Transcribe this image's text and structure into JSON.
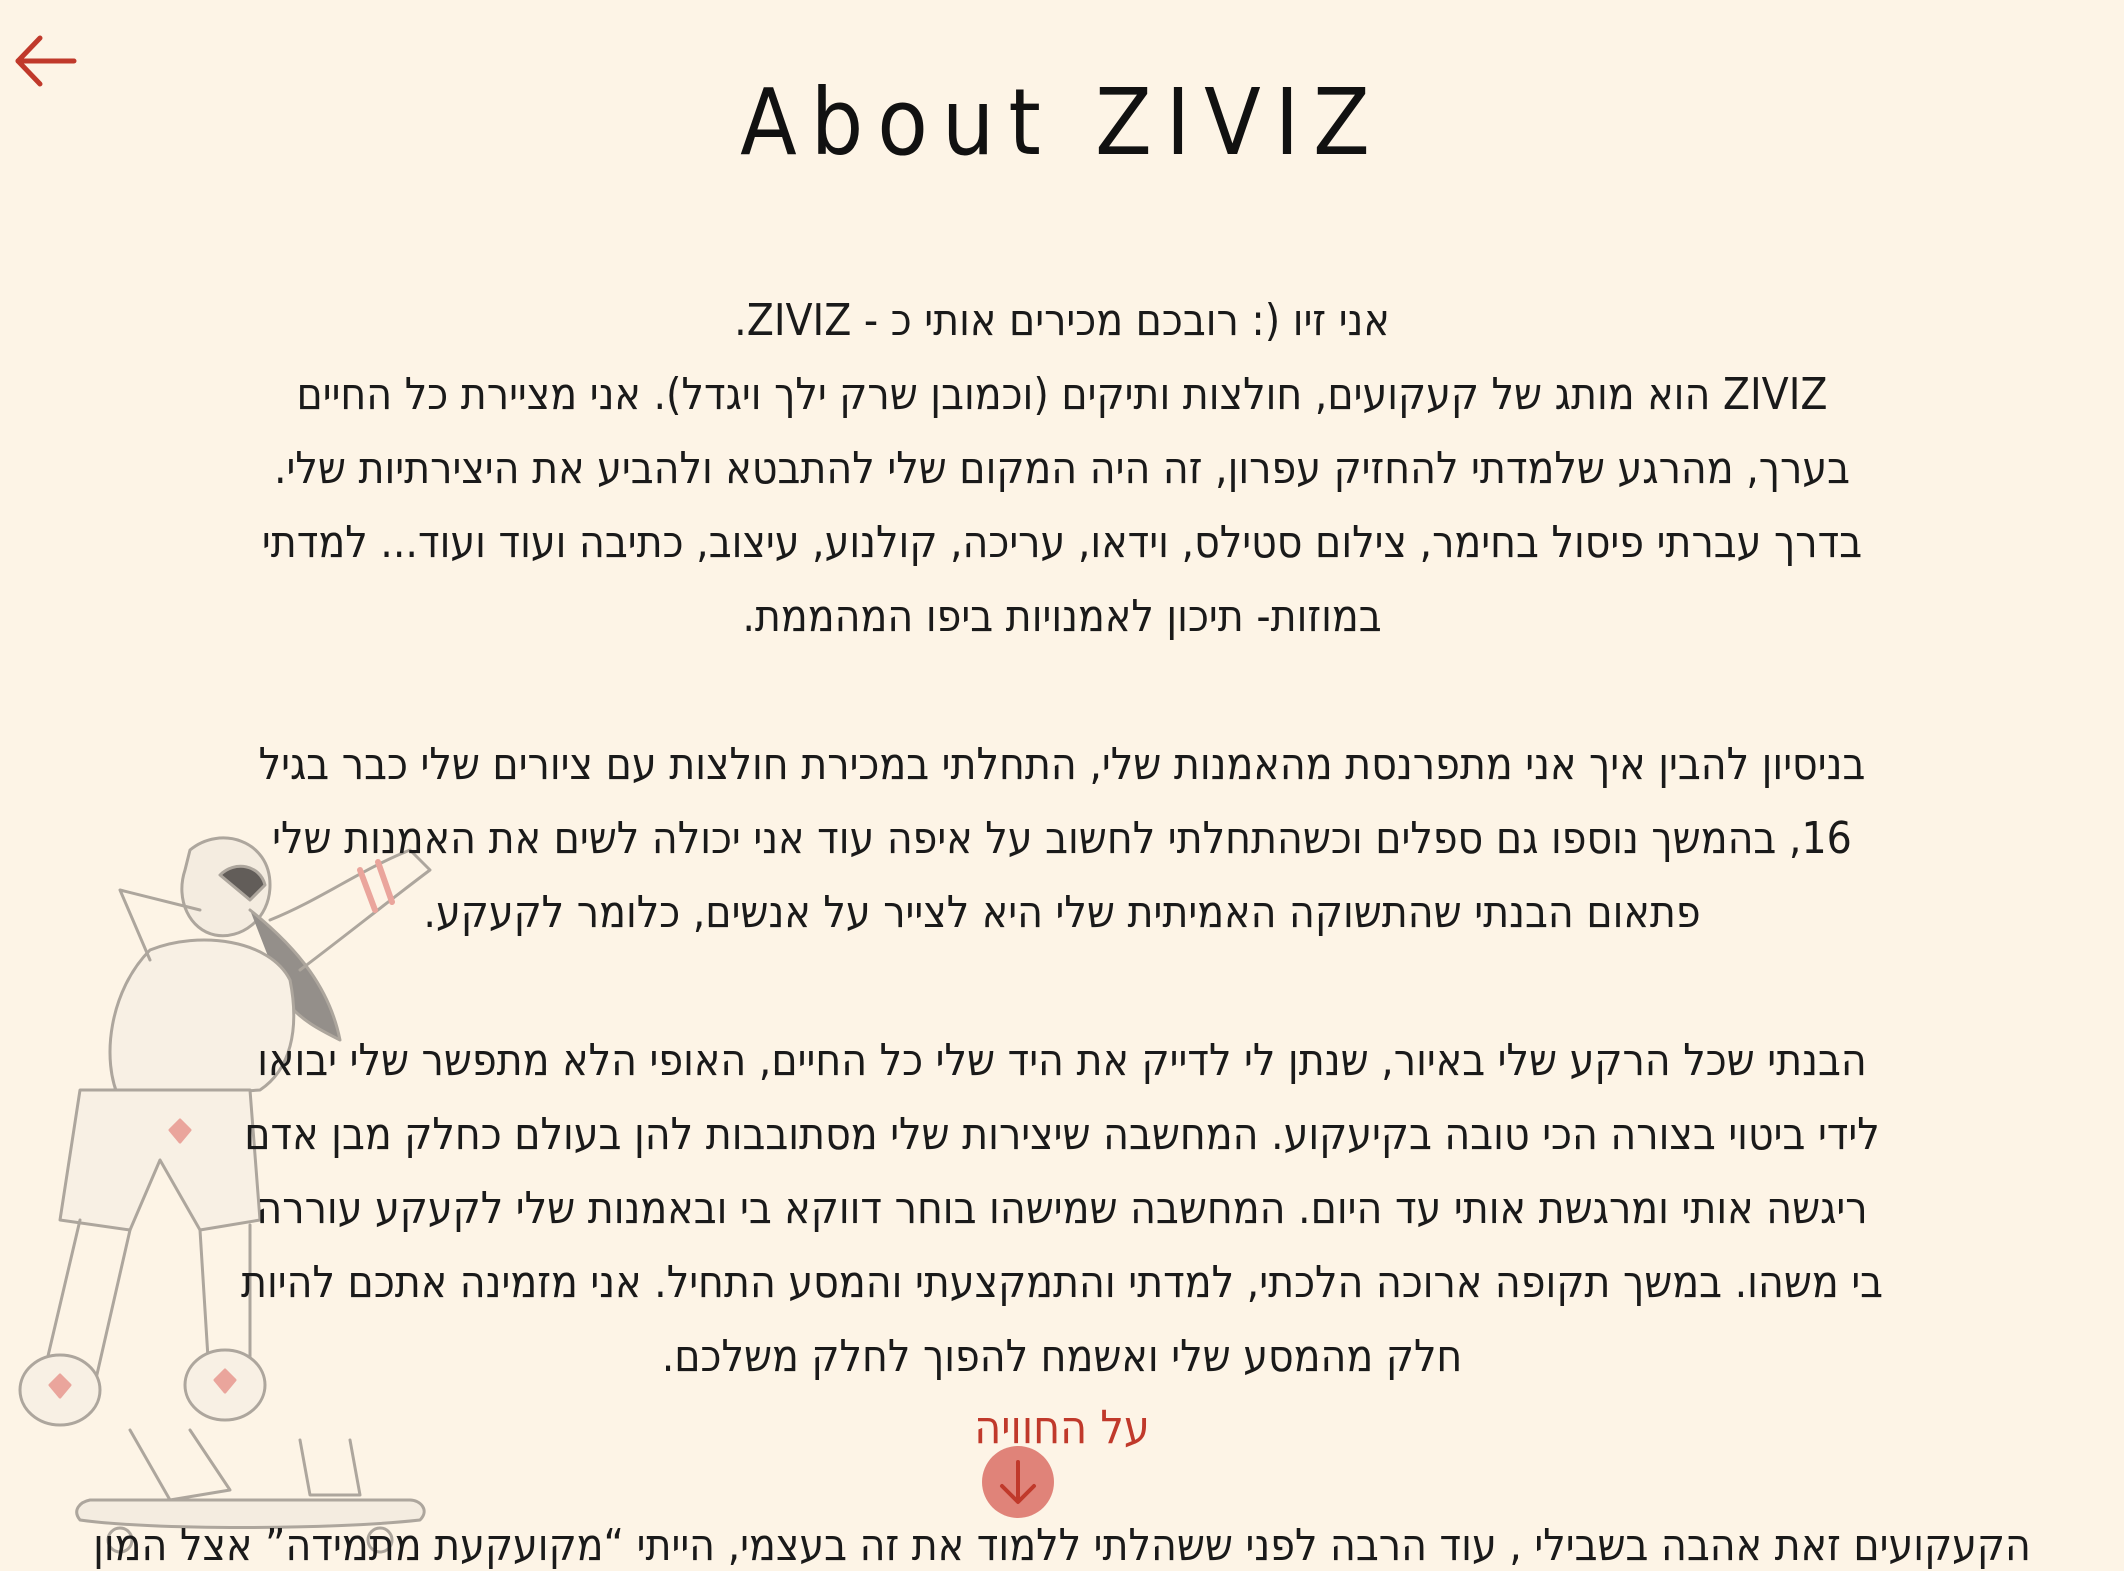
{
  "title": "About ZIVIZ",
  "paragraphs": [
    "אני זיו (: רובכם מכירים אותי כ - ZIVIZ.",
    "ZIVIZ הוא מותג של קעקועים, חולצות ותיקים (וכמובן שרק ילך ויגדל). אני מציירת כל החיים בערך, מהרגע שלמדתי להחזיק עפרון, זה היה המקום שלי להתבטא ולהביע את היצירתיות שלי. בדרך עברתי פיסול בחימר, צילום סטילס, וידאו, עריכה, קולנוע, עיצוב, כתיבה ועוד ועוד... למדתי במוזות- תיכון לאמנויות ביפו המהממת.",
    "בניסיון להבין איך אני מתפרנסת מהאמנות שלי, התחלתי במכירת חולצות עם ציורים שלי כבר בגיל 16, בהמשך נוספו גם ספלים וכשהתחלתי לחשוב על איפה עוד אני יכולה לשים את האמנות שלי פתאום הבנתי שהתשוקה האמיתית שלי היא לצייר על אנשים, כלומר לקעקע.",
    "הבנתי שכל הרקע שלי באיור, שנתן לי לדייק את היד שלי כל החיים, האופי הלא מתפשר שלי יבואו לידי ביטוי בצורה הכי טובה בקיעקוע. המחשבה שיצירות שלי מסתובבות להן בעולם כחלק מבן אדם ריגשה אותי ומרגשת אותי עד היום. המחשבה שמישהו בוחר דווקא בי ובאמנות שלי לקעקע עוררה בי משהו. במשך תקופה ארוכה הלכתי, למדתי והתמקצעתי והמסע התחיל. אני מזמינה אתכם להיות חלק מהמסע שלי ואשמח להפוך לחלק משלכם."
  ],
  "cta_label": "על החוויה",
  "cut_text": "הקעקועים זאת אהבה בשבילי , עוד הרבה לפני ששהלתי ללמוד את זה בעצמי, הייתי “מקועקעת מתמידה” אצל המון",
  "icons": {
    "back": "arrow-left-icon",
    "scroll": "arrow-down-icon"
  },
  "colors": {
    "background": "#fdf4e6",
    "accent": "#c0392b",
    "scroll_button": "#d65e54"
  }
}
